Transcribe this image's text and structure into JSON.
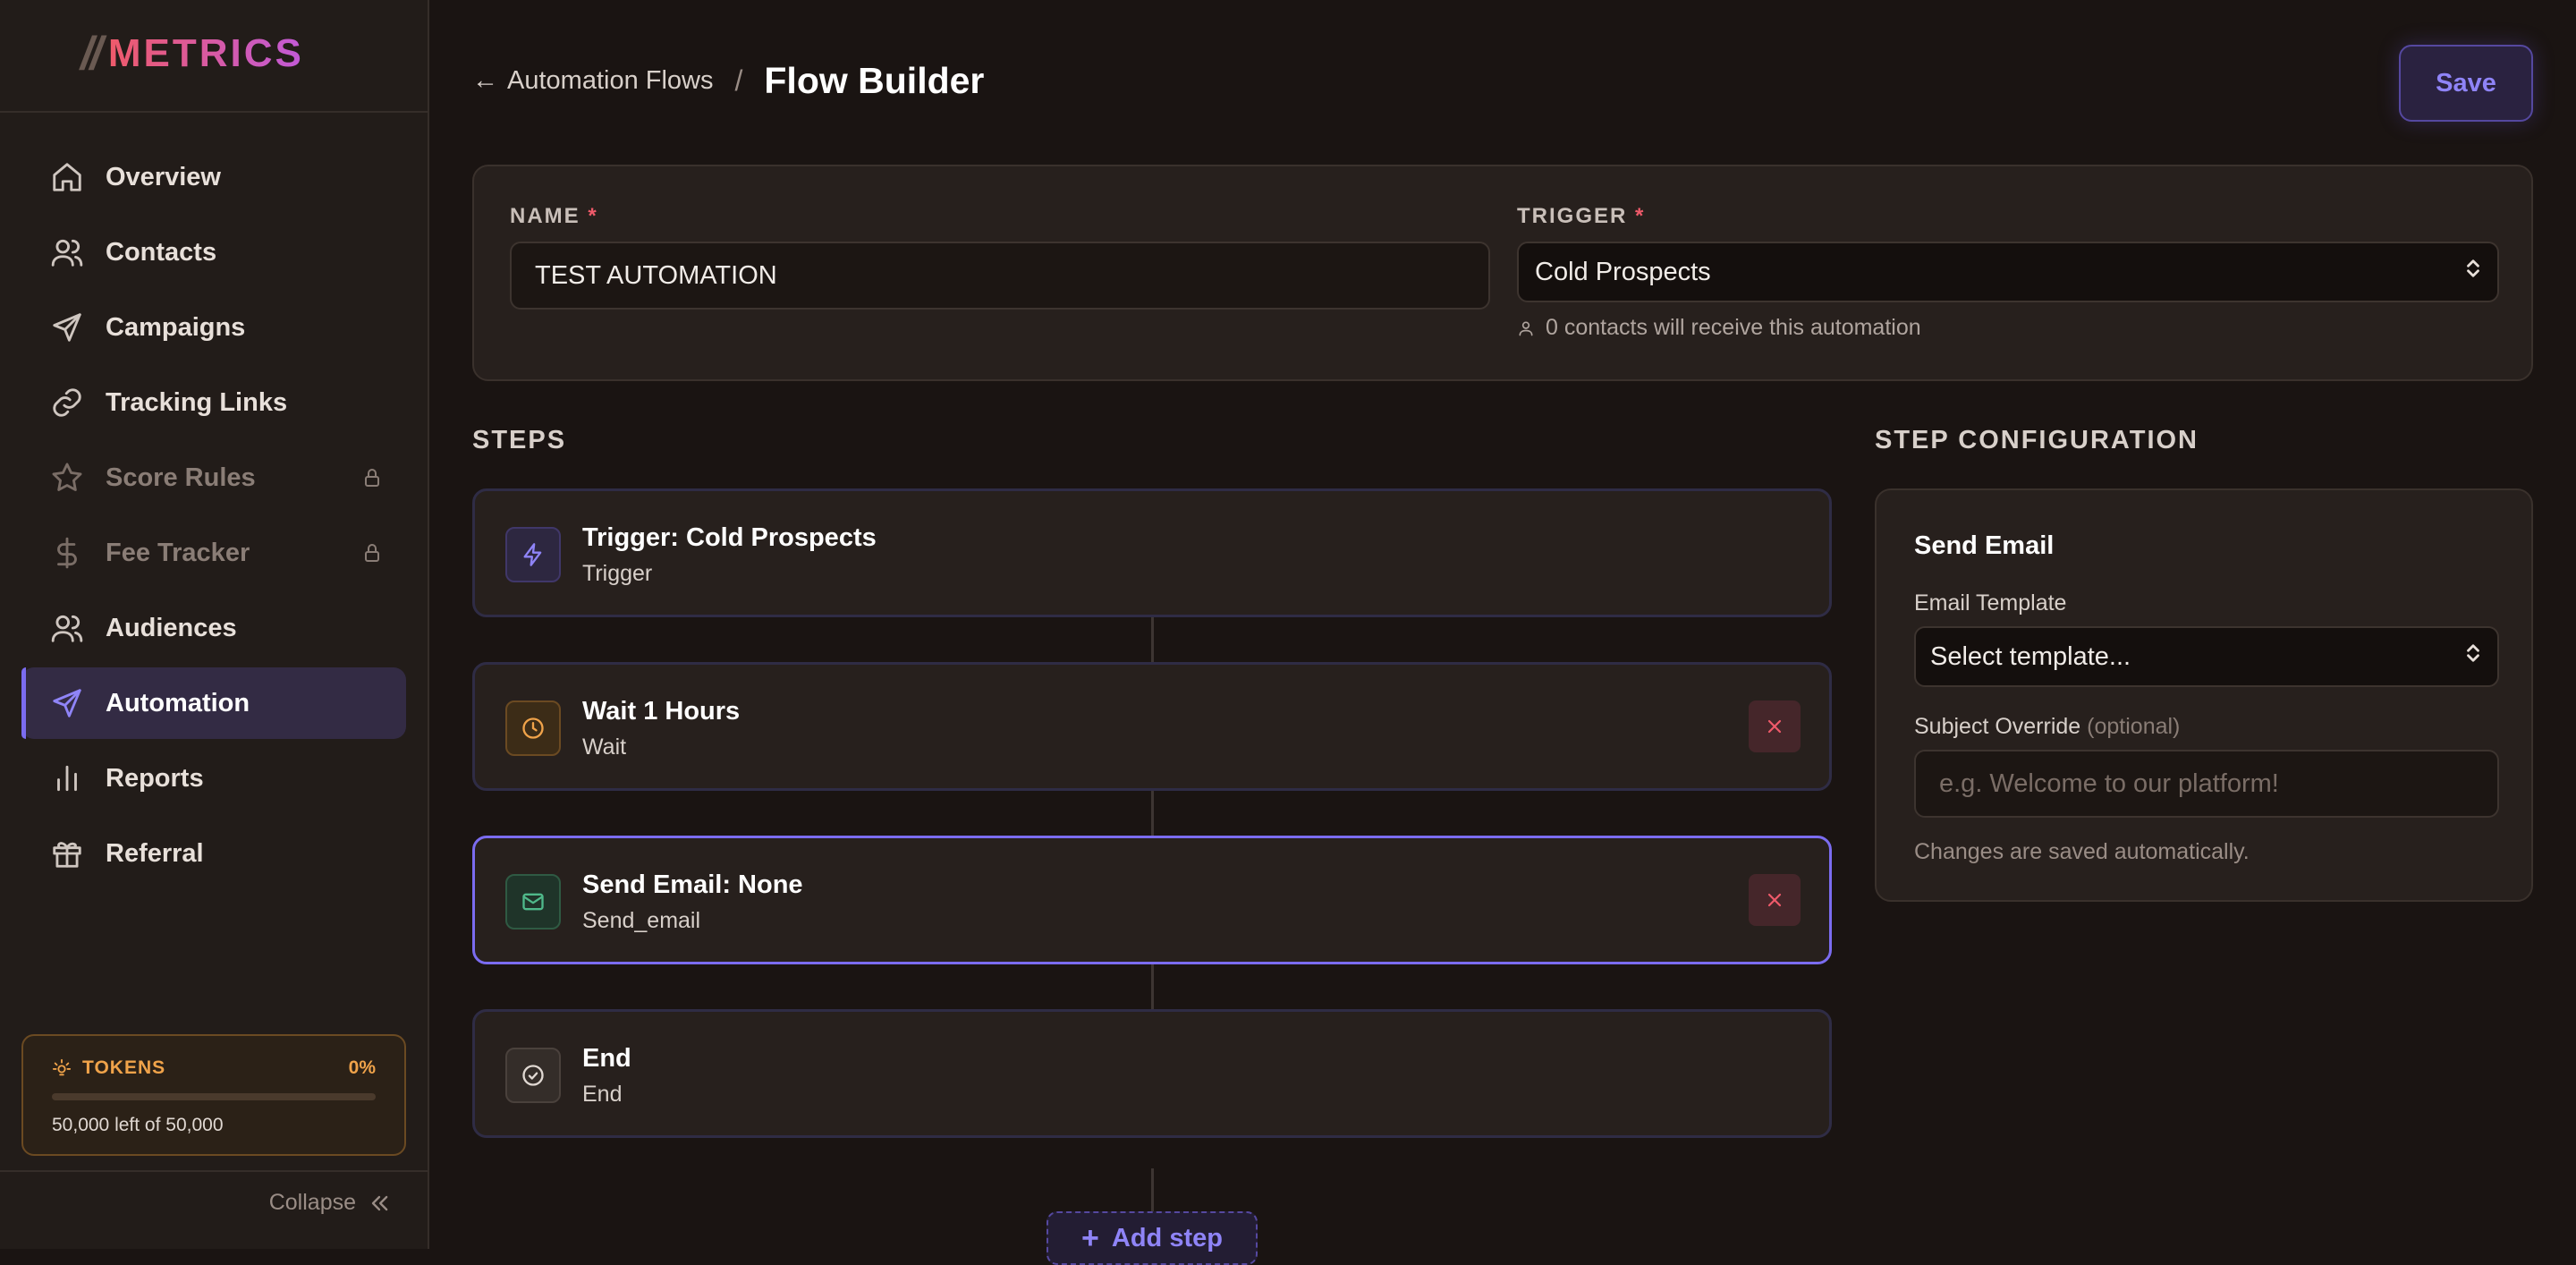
{
  "brand": {
    "slashes": "//",
    "name": "METRICS"
  },
  "sidebar": {
    "items": [
      {
        "label": "Overview",
        "icon": "home-icon"
      },
      {
        "label": "Contacts",
        "icon": "users-icon"
      },
      {
        "label": "Campaigns",
        "icon": "send-icon"
      },
      {
        "label": "Tracking Links",
        "icon": "link-icon"
      },
      {
        "label": "Score Rules",
        "icon": "star-icon",
        "locked": true
      },
      {
        "label": "Fee Tracker",
        "icon": "dollar-icon",
        "locked": true
      },
      {
        "label": "Audiences",
        "icon": "users-icon"
      },
      {
        "label": "Automation",
        "icon": "send-icon",
        "active": true
      },
      {
        "label": "Reports",
        "icon": "bar-chart-icon"
      },
      {
        "label": "Referral",
        "icon": "gift-icon"
      }
    ],
    "tokens": {
      "label": "TOKENS",
      "percent": "0%",
      "usage_fraction": 0,
      "left_text": "50,000 left of 50,000"
    },
    "collapse_label": "Collapse"
  },
  "header": {
    "back_label": "Automation Flows",
    "back_arrow": "←",
    "separator": "/",
    "title": "Flow Builder",
    "save_label": "Save"
  },
  "form": {
    "name_label": "NAME",
    "required_mark": "*",
    "name_value": "TEST AUTOMATION",
    "trigger_label": "TRIGGER",
    "trigger_value": "Cold Prospects",
    "trigger_hint": "0 contacts will receive this automation"
  },
  "steps_title": "STEPS",
  "steps": [
    {
      "title": "Trigger: Cold Prospects",
      "type": "Trigger",
      "icon": "lightning-icon",
      "color": "#7b6cf0"
    },
    {
      "title": "Wait 1 Hours",
      "type": "Wait",
      "icon": "clock-icon",
      "color": "#f0a34a"
    },
    {
      "title": "Send Email: None",
      "type": "Send_email",
      "icon": "mail-icon",
      "color": "#4fb98a"
    },
    {
      "title": "End",
      "type": "End",
      "icon": "check-circle-icon",
      "color": "#c9bfb9"
    }
  ],
  "add_step_label": "Add step",
  "config": {
    "section_title": "STEP CONFIGURATION",
    "title": "Send Email",
    "template_label": "Email Template",
    "template_value": "Select template...",
    "subject_label": "Subject Override",
    "subject_optional": "(optional)",
    "subject_placeholder": "e.g. Welcome to our platform!",
    "note": "Changes are saved automatically."
  },
  "colors": {
    "accent": "#7b6cf0",
    "danger": "#ef5a6a",
    "warning": "#f0a34a"
  }
}
